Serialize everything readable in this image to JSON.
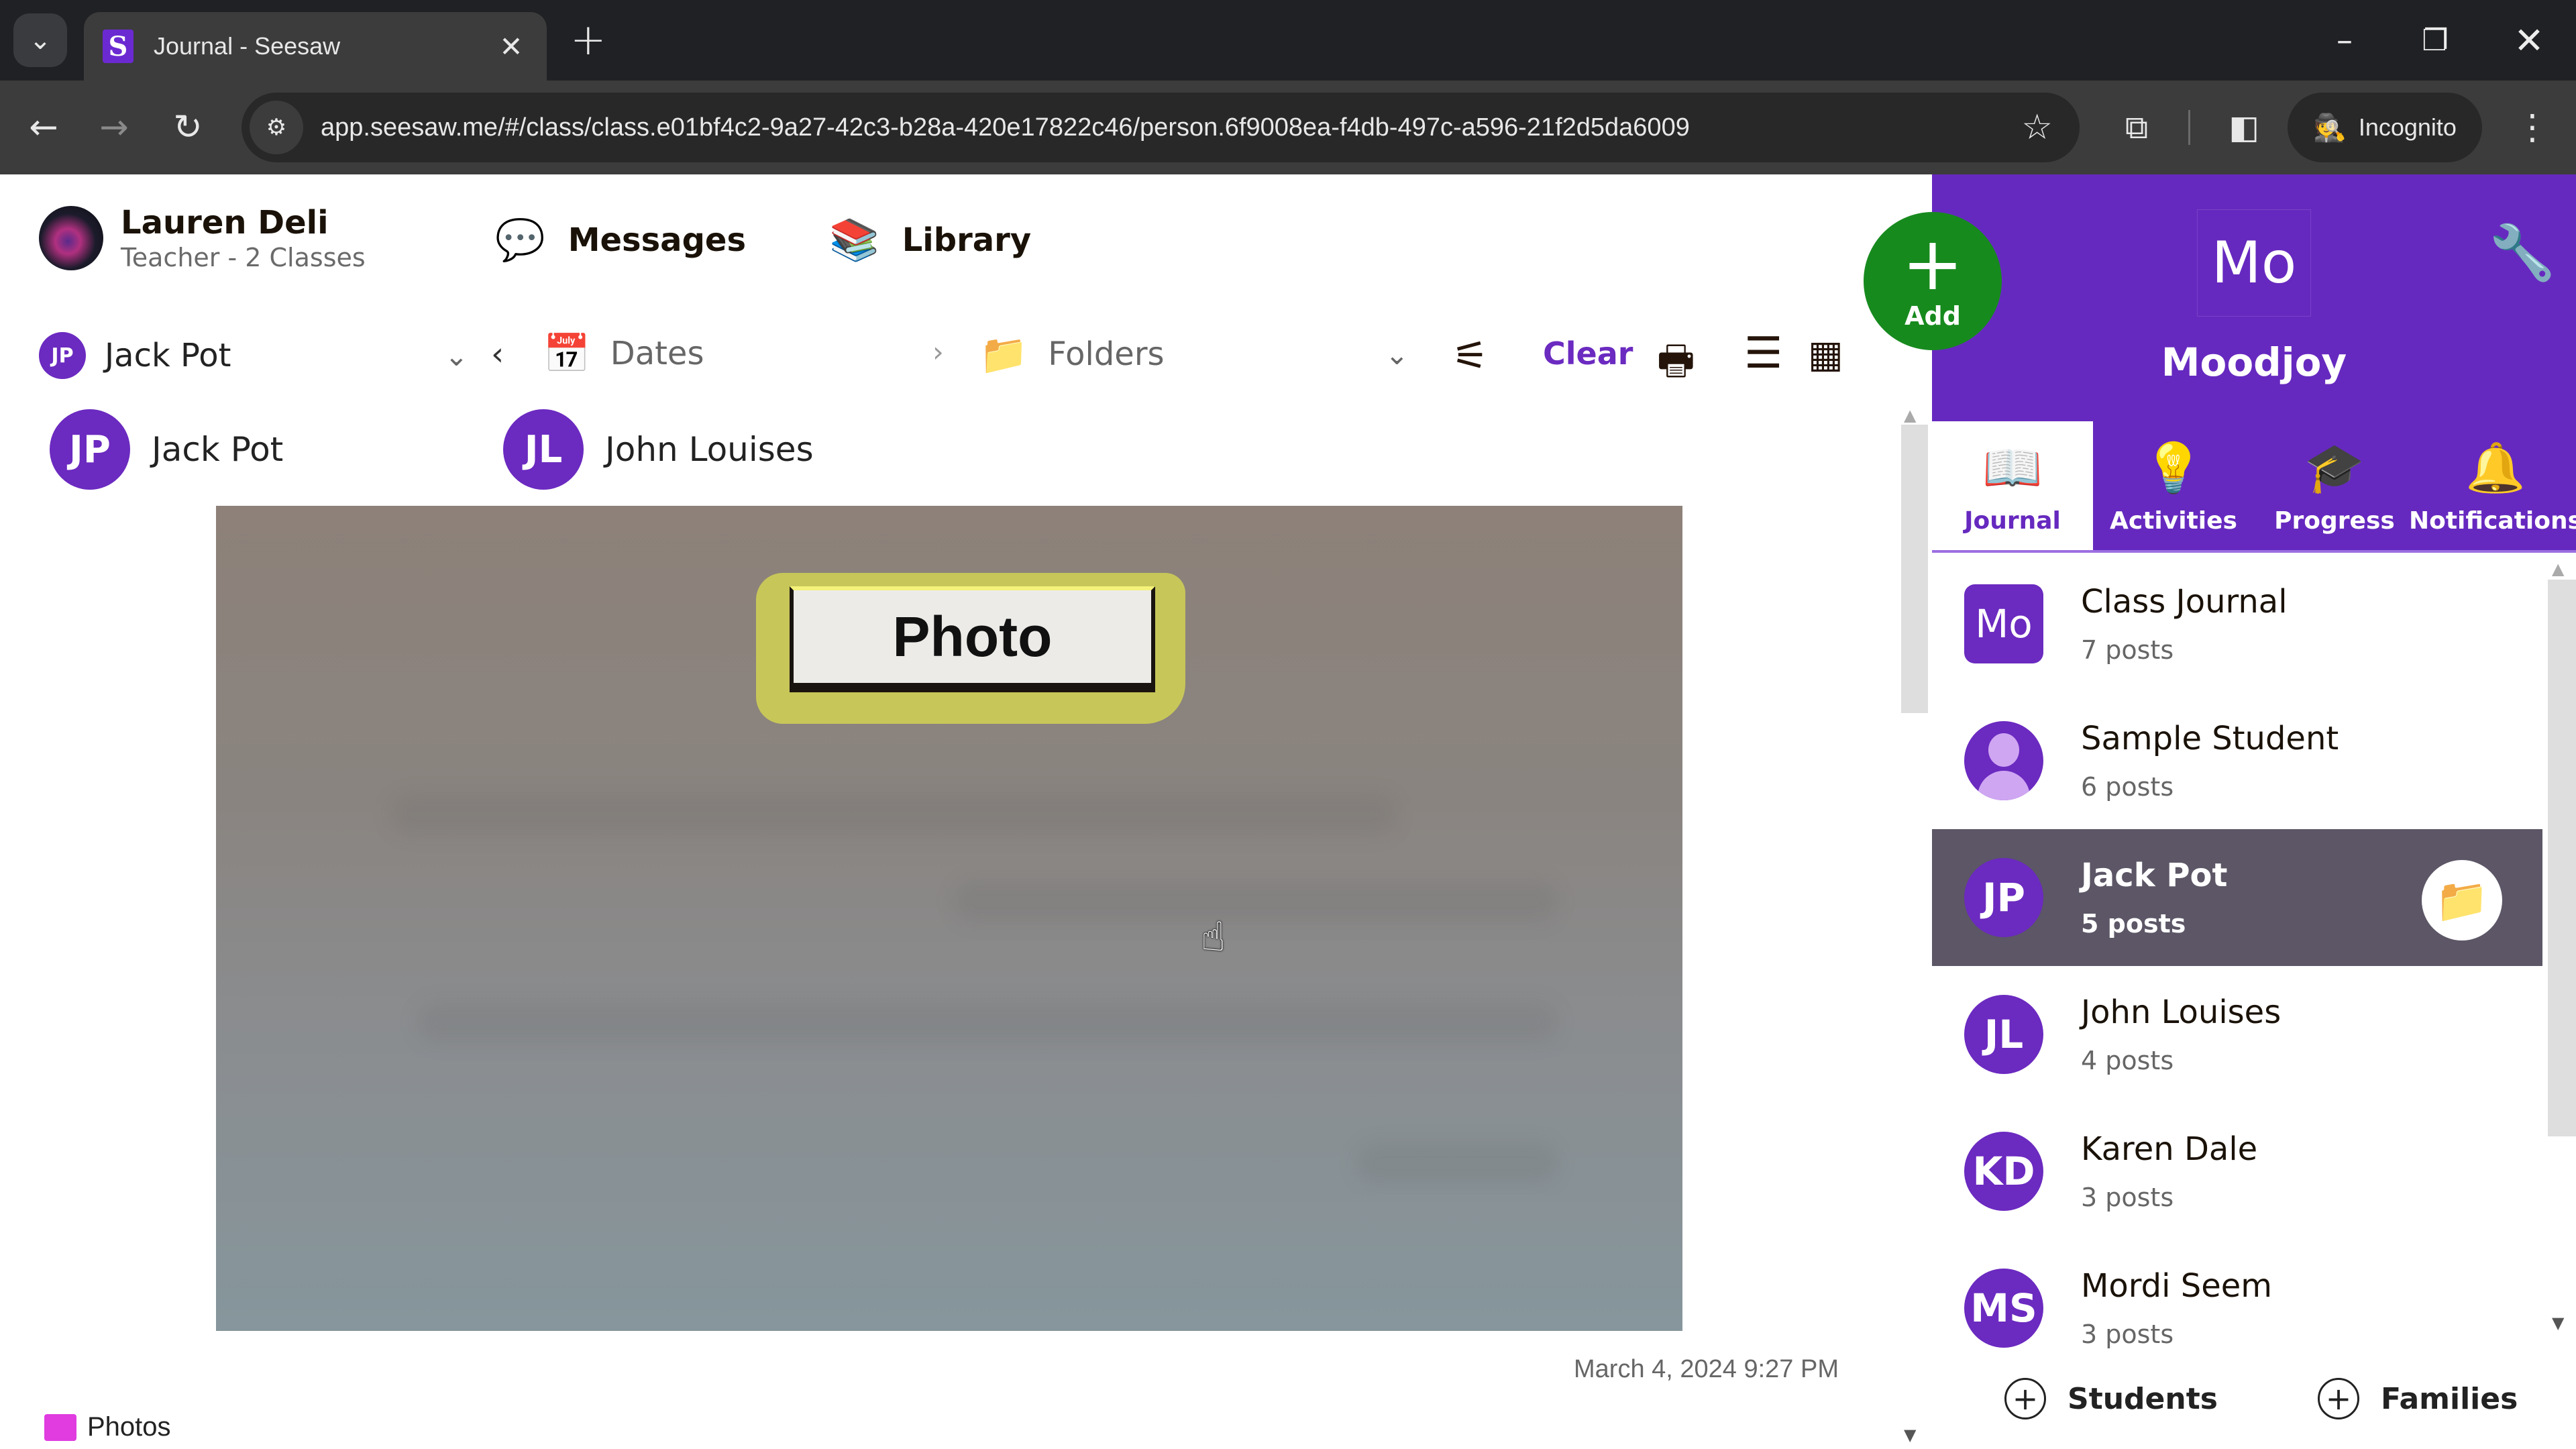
{
  "browser": {
    "tab_title": "Journal - Seesaw",
    "favicon_letter": "S",
    "url": "app.seesaw.me/#/class/class.e01bf4c2-9a27-42c3-b28a-420e17822c46/person.6f9008ea-f4db-497c-a596-21f2d5da6009",
    "incognito_label": "Incognito",
    "icons": {
      "tab_search": "⌄",
      "tab_close": "✕",
      "new_tab": "+",
      "minimize": "–",
      "restore": "❐",
      "close": "✕",
      "back": "←",
      "forward": "→",
      "reload": "↻",
      "site_info": "⚙",
      "bookmark": "☆",
      "extensions": "⧉",
      "side_panel": "◧",
      "incognito": "🕵",
      "menu": "⋮"
    }
  },
  "header": {
    "user_name": "Lauren Deli",
    "user_role": "Teacher - 2 Classes",
    "messages_label": "Messages",
    "library_label": "Library",
    "messages_icon": "💬",
    "library_icon": "📚"
  },
  "filters": {
    "student_initials": "JP",
    "student_selected": "Jack Pot",
    "dates_label": "Dates",
    "folders_label": "Folders",
    "clear_label": "Clear",
    "icons": {
      "chevron_down": "⌄",
      "prev": "‹",
      "next": "›",
      "calendar": "📅",
      "folder": "📁",
      "filter": "⚟",
      "print": "🖶",
      "list": "☰",
      "calendar_grid": "▦"
    }
  },
  "post": {
    "tagged_students": [
      {
        "initials": "JP",
        "name": "Jack Pot"
      },
      {
        "initials": "JL",
        "name": "John Louises"
      }
    ],
    "photo_label_text": "Photo",
    "timestamp": "March 4, 2024 9:27 PM",
    "folder_name": "Photos",
    "folder_color": "#e03ce0"
  },
  "class_panel": {
    "add_label": "Add",
    "class_avatar": "Mo",
    "class_name": "Moodjoy",
    "tabs": [
      {
        "label": "Journal",
        "icon": "📖",
        "active": true
      },
      {
        "label": "Activities",
        "icon": "💡",
        "active": false
      },
      {
        "label": "Progress",
        "icon": "🎓",
        "active": false
      },
      {
        "label": "Notifications",
        "icon": "🔔",
        "active": false
      }
    ],
    "list": [
      {
        "initials": "Mo",
        "name": "Class Journal",
        "posts": "7 posts",
        "type": "class"
      },
      {
        "initials": "",
        "name": "Sample Student",
        "posts": "6 posts",
        "type": "generic"
      },
      {
        "initials": "JP",
        "name": "Jack Pot",
        "posts": "5 posts",
        "type": "student",
        "selected": true
      },
      {
        "initials": "JL",
        "name": "John Louises",
        "posts": "4 posts",
        "type": "student"
      },
      {
        "initials": "KD",
        "name": "Karen Dale",
        "posts": "3 posts",
        "type": "student"
      },
      {
        "initials": "MS",
        "name": "Mordi Seem",
        "posts": "3 posts",
        "type": "student"
      }
    ],
    "footer": {
      "students_label": "Students",
      "families_label": "Families"
    }
  },
  "colors": {
    "brand_purple": "#6629bf",
    "add_green": "#178a1e",
    "selected_row": "#5c5666"
  }
}
